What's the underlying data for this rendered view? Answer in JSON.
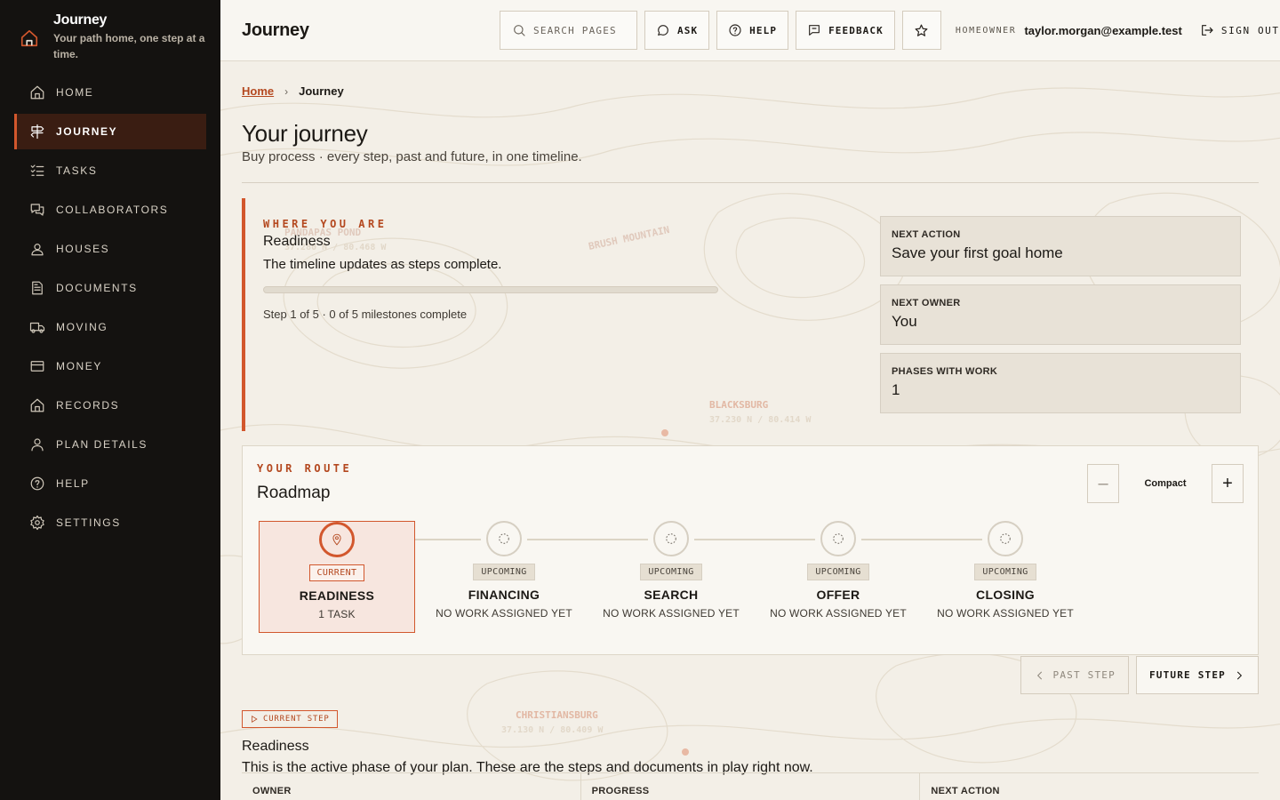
{
  "brand": {
    "title": "Journey",
    "tagline": "Your path home, one step at a time."
  },
  "sidebar": {
    "items": [
      {
        "label": "HOME",
        "icon": "home-icon",
        "active": false
      },
      {
        "label": "JOURNEY",
        "icon": "signpost-icon",
        "active": true
      },
      {
        "label": "TASKS",
        "icon": "checklist-icon",
        "active": false
      },
      {
        "label": "COLLABORATORS",
        "icon": "chat-icon",
        "active": false
      },
      {
        "label": "HOUSES",
        "icon": "houses-icon",
        "active": false
      },
      {
        "label": "DOCUMENTS",
        "icon": "document-icon",
        "active": false
      },
      {
        "label": "MOVING",
        "icon": "truck-icon",
        "active": false
      },
      {
        "label": "MONEY",
        "icon": "card-icon",
        "active": false
      },
      {
        "label": "RECORDS",
        "icon": "records-icon",
        "active": false
      },
      {
        "label": "PLAN DETAILS",
        "icon": "user-icon",
        "active": false
      },
      {
        "label": "HELP",
        "icon": "help-icon",
        "active": false
      },
      {
        "label": "SETTINGS",
        "icon": "gear-icon",
        "active": false
      }
    ]
  },
  "header": {
    "page_name": "Journey",
    "search_placeholder": "SEARCH PAGES",
    "ask": "ASK",
    "help": "HELP",
    "feedback": "FEEDBACK",
    "role": "HOMEOWNER",
    "email": "taylor.morgan@example.test",
    "signout": "SIGN OUT"
  },
  "breadcrumb": {
    "home": "Home",
    "current": "Journey"
  },
  "page": {
    "title": "Your journey",
    "subtitle": "Buy process · every step, past and future, in one timeline."
  },
  "where": {
    "eyebrow": "WHERE YOU ARE",
    "phase": "Readiness",
    "desc": "The timeline updates as steps complete.",
    "progress": 0,
    "step_info": "Step 1 of 5 · 0 of 5 milestones complete"
  },
  "cards": [
    {
      "label": "NEXT ACTION",
      "value": "Save your first goal home"
    },
    {
      "label": "NEXT OWNER",
      "value": "You"
    },
    {
      "label": "PHASES WITH WORK",
      "value": "1"
    }
  ],
  "map_labels": [
    {
      "name": "PANDAPAS POND",
      "coord": "37.280 N / 80.468 W"
    },
    {
      "name": "BRUSH MOUNTAIN",
      "coord": ""
    },
    {
      "name": "BLACKSBURG",
      "coord": "37.230 N / 80.414 W"
    },
    {
      "name": "CHRISTIANSBURG",
      "coord": "37.130 N / 80.409 W"
    }
  ],
  "route": {
    "eyebrow": "YOUR ROUTE",
    "title": "Roadmap",
    "zoom_label": "Compact",
    "stops": [
      {
        "status": "CURRENT",
        "name": "READINESS",
        "meta": "1 TASK",
        "current": true
      },
      {
        "status": "UPCOMING",
        "name": "FINANCING",
        "meta": "NO WORK ASSIGNED YET",
        "current": false
      },
      {
        "status": "UPCOMING",
        "name": "SEARCH",
        "meta": "NO WORK ASSIGNED YET",
        "current": false
      },
      {
        "status": "UPCOMING",
        "name": "OFFER",
        "meta": "NO WORK ASSIGNED YET",
        "current": false
      },
      {
        "status": "UPCOMING",
        "name": "CLOSING",
        "meta": "NO WORK ASSIGNED YET",
        "current": false
      }
    ]
  },
  "pager": {
    "prev": "PAST STEP",
    "next": "FUTURE STEP"
  },
  "current_step": {
    "badge": "CURRENT STEP",
    "name": "Readiness",
    "desc": "This is the active phase of your plan. These are the steps and documents in play right now.",
    "columns": [
      "OWNER",
      "PROGRESS",
      "NEXT ACTION"
    ]
  },
  "colors": {
    "accent": "#d2572d",
    "sidebar_bg": "#141210",
    "active_bg": "#3a1d12",
    "page_bg": "#f3efe7"
  }
}
